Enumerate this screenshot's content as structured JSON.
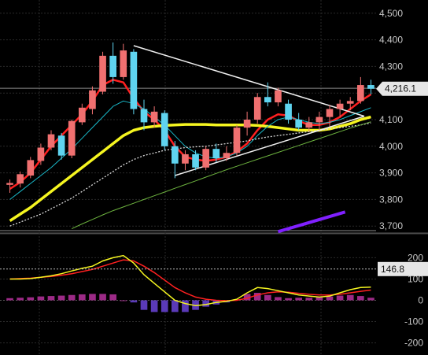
{
  "chart_data": [
    {
      "type": "candlestick",
      "panel": "price",
      "ylim": [
        3680,
        4520
      ],
      "y_ticks": [
        "4,500",
        "4,400",
        "4,300",
        "4,200",
        "4,100",
        "4,000",
        "3,900",
        "3,800",
        "3,700"
      ],
      "y_tick_values": [
        4500,
        4400,
        4300,
        4200,
        4100,
        4000,
        3900,
        3800,
        3700
      ],
      "last_price": 4216.1,
      "last_price_label": "4,216.1",
      "n_bars": 35,
      "candles": [
        {
          "o": 3855,
          "h": 3875,
          "l": 3825,
          "c": 3862
        },
        {
          "o": 3860,
          "h": 3905,
          "l": 3845,
          "c": 3895
        },
        {
          "o": 3890,
          "h": 3960,
          "l": 3880,
          "c": 3948
        },
        {
          "o": 3945,
          "h": 4010,
          "l": 3930,
          "c": 3995
        },
        {
          "o": 3995,
          "h": 4060,
          "l": 3985,
          "c": 4045
        },
        {
          "o": 4040,
          "h": 4050,
          "l": 3950,
          "c": 3965
        },
        {
          "o": 3965,
          "h": 4100,
          "l": 3955,
          "c": 4095
        },
        {
          "o": 4090,
          "h": 4160,
          "l": 4080,
          "c": 4145
        },
        {
          "o": 4140,
          "h": 4225,
          "l": 4120,
          "c": 4210
        },
        {
          "o": 4205,
          "h": 4355,
          "l": 4195,
          "c": 4340
        },
        {
          "o": 4340,
          "h": 4390,
          "l": 4235,
          "c": 4260
        },
        {
          "o": 4260,
          "h": 4385,
          "l": 4250,
          "c": 4360
        },
        {
          "o": 4355,
          "h": 4365,
          "l": 4120,
          "c": 4140
        },
        {
          "o": 4140,
          "h": 4175,
          "l": 4060,
          "c": 4090
        },
        {
          "o": 4090,
          "h": 4150,
          "l": 4070,
          "c": 4130
        },
        {
          "o": 4125,
          "h": 4135,
          "l": 3985,
          "c": 4000
        },
        {
          "o": 4000,
          "h": 4020,
          "l": 3880,
          "c": 3935
        },
        {
          "o": 3935,
          "h": 3985,
          "l": 3910,
          "c": 3970
        },
        {
          "o": 3970,
          "h": 3985,
          "l": 3910,
          "c": 3920
        },
        {
          "o": 3920,
          "h": 4000,
          "l": 3910,
          "c": 3990
        },
        {
          "o": 3990,
          "h": 4010,
          "l": 3940,
          "c": 3955
        },
        {
          "o": 3955,
          "h": 4000,
          "l": 3945,
          "c": 3975
        },
        {
          "o": 3975,
          "h": 4080,
          "l": 3965,
          "c": 4070
        },
        {
          "o": 4070,
          "h": 4130,
          "l": 4040,
          "c": 4100
        },
        {
          "o": 4100,
          "h": 4200,
          "l": 4085,
          "c": 4185
        },
        {
          "o": 4185,
          "h": 4240,
          "l": 4150,
          "c": 4165
        },
        {
          "o": 4165,
          "h": 4220,
          "l": 4150,
          "c": 4210
        },
        {
          "o": 4160,
          "h": 4175,
          "l": 4085,
          "c": 4100
        },
        {
          "o": 4100,
          "h": 4125,
          "l": 4060,
          "c": 4070
        },
        {
          "o": 4070,
          "h": 4110,
          "l": 4055,
          "c": 4090
        },
        {
          "o": 4090,
          "h": 4130,
          "l": 4060,
          "c": 4110
        },
        {
          "o": 4110,
          "h": 4155,
          "l": 4075,
          "c": 4140
        },
        {
          "o": 4140,
          "h": 4175,
          "l": 4110,
          "c": 4160
        },
        {
          "o": 4160,
          "h": 4185,
          "l": 4135,
          "c": 4170
        },
        {
          "o": 4170,
          "h": 4260,
          "l": 4160,
          "c": 4230
        },
        {
          "o": 4230,
          "h": 4250,
          "l": 4195,
          "c": 4216
        }
      ],
      "moving_averages": [
        {
          "color": "#ff2020",
          "width": 2.5,
          "values": [
            3840,
            3865,
            3900,
            3950,
            4000,
            4040,
            4080,
            4120,
            4170,
            4230,
            4250,
            4240,
            4180,
            4130,
            4100,
            4060,
            4000,
            3960,
            3950,
            3945,
            3950,
            3960,
            3980,
            4010,
            4060,
            4100,
            4120,
            4115,
            4095,
            4080,
            4080,
            4090,
            4110,
            4140,
            4170,
            4195
          ]
        },
        {
          "color": "#f5f520",
          "width": 3.5,
          "values": [
            3720,
            3745,
            3770,
            3800,
            3830,
            3860,
            3890,
            3920,
            3950,
            3980,
            4010,
            4040,
            4060,
            4070,
            4075,
            4078,
            4080,
            4082,
            4082,
            4082,
            4080,
            4080,
            4080,
            4080,
            4078,
            4075,
            4070,
            4065,
            4060,
            4060,
            4060,
            4065,
            4075,
            4085,
            4100,
            4110
          ]
        },
        {
          "color": "#19b8c8",
          "width": 1,
          "values": [
            3800,
            3830,
            3860,
            3890,
            3920,
            3955,
            3990,
            4030,
            4070,
            4110,
            4150,
            4170,
            4160,
            4140,
            4110,
            4080,
            4040,
            4000,
            3975,
            3960,
            3955,
            3960,
            3975,
            4000,
            4040,
            4075,
            4100,
            4110,
            4100,
            4090,
            4085,
            4090,
            4100,
            4115,
            4130,
            4145
          ]
        },
        {
          "color": "#d9d9d9",
          "width": 1.3,
          "dash": "2,2",
          "values": [
            3700,
            3715,
            3730,
            3745,
            3765,
            3785,
            3805,
            3830,
            3855,
            3880,
            3905,
            3930,
            3950,
            3965,
            3975,
            3985,
            3990,
            3995,
            3998,
            4000,
            4005,
            4010,
            4015,
            4020,
            4028,
            4035,
            4040,
            4045,
            4050,
            4055,
            4060,
            4065,
            4070,
            4075,
            4080,
            4088
          ]
        },
        {
          "color": "#6db33f",
          "width": 1,
          "start": 6,
          "values": [
            3690,
            3708,
            3725,
            3742,
            3758,
            3772,
            3786,
            3800,
            3814,
            3828,
            3842,
            3856,
            3870,
            3884,
            3898,
            3912,
            3925,
            3938,
            3951,
            3964,
            3977,
            3990,
            4003,
            4016,
            4029,
            4042,
            4055,
            4068,
            4080,
            4092
          ]
        }
      ],
      "resistance_line": {
        "points": [
          [
            12,
            4378
          ],
          [
            36,
            4113
          ]
        ]
      },
      "support_line": {
        "points": [
          [
            16,
            3890
          ],
          [
            36,
            4113
          ]
        ]
      },
      "horizontal_lines": [
        4218,
        3683
      ],
      "purple_line": {
        "color": "#8020ff",
        "points": [
          [
            26,
            3679
          ],
          [
            32.5,
            3753
          ]
        ]
      }
    },
    {
      "type": "macd",
      "panel": "oscillator",
      "ylim": [
        -220,
        220
      ],
      "y_ticks": [
        "200",
        "100",
        "0",
        "-100",
        "-200"
      ],
      "y_tick_values": [
        200,
        100,
        0,
        -100,
        -200
      ],
      "current_value_label": "146.8",
      "current_value": 146.8,
      "macd": [
        100,
        100,
        102,
        108,
        115,
        125,
        138,
        150,
        160,
        185,
        200,
        210,
        175,
        120,
        80,
        40,
        0,
        -15,
        -25,
        -20,
        -10,
        -5,
        5,
        35,
        60,
        55,
        45,
        35,
        25,
        20,
        15,
        20,
        35,
        50,
        60,
        62
      ],
      "signal": [
        100,
        102,
        104,
        108,
        112,
        118,
        125,
        135,
        145,
        160,
        175,
        190,
        185,
        160,
        130,
        95,
        60,
        35,
        15,
        5,
        0,
        -2,
        0,
        10,
        25,
        35,
        40,
        38,
        33,
        28,
        25,
        25,
        28,
        35,
        42,
        48
      ],
      "histogram": [
        10,
        12,
        14,
        18,
        20,
        22,
        25,
        28,
        30,
        30,
        28,
        0,
        -10,
        -45,
        -55,
        -55,
        -55,
        -55,
        -45,
        -30,
        -20,
        -10,
        5,
        30,
        35,
        25,
        15,
        10,
        12,
        12,
        15,
        18,
        22,
        25,
        20,
        12
      ]
    }
  ]
}
